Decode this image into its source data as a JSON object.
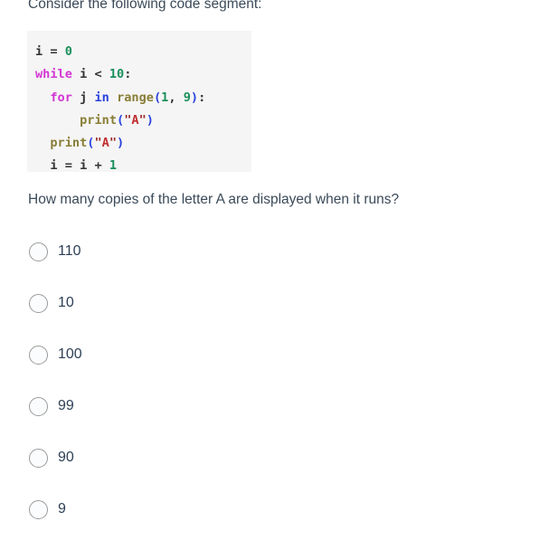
{
  "prompt": "Consider the following code segment:",
  "code": {
    "language": "python",
    "lines": [
      [
        {
          "t": "i",
          "c": "tok-name"
        },
        {
          "t": " ",
          "c": "tok-plain"
        },
        {
          "t": "=",
          "c": "tok-plain"
        },
        {
          "t": " ",
          "c": "tok-plain"
        },
        {
          "t": "0",
          "c": "tok-num"
        }
      ],
      [
        {
          "t": "while",
          "c": "tok-kw"
        },
        {
          "t": " ",
          "c": "tok-plain"
        },
        {
          "t": "i",
          "c": "tok-name"
        },
        {
          "t": " ",
          "c": "tok-plain"
        },
        {
          "t": "<",
          "c": "tok-plain"
        },
        {
          "t": " ",
          "c": "tok-plain"
        },
        {
          "t": "10",
          "c": "tok-num"
        },
        {
          "t": ":",
          "c": "tok-plain"
        }
      ],
      [
        {
          "t": "  ",
          "c": "tok-plain"
        },
        {
          "t": "for",
          "c": "tok-kw"
        },
        {
          "t": " ",
          "c": "tok-plain"
        },
        {
          "t": "j",
          "c": "tok-name"
        },
        {
          "t": " ",
          "c": "tok-plain"
        },
        {
          "t": "in",
          "c": "tok-op-in"
        },
        {
          "t": " ",
          "c": "tok-plain"
        },
        {
          "t": "range",
          "c": "tok-builtin"
        },
        {
          "t": "(",
          "c": "tok-punc"
        },
        {
          "t": "1",
          "c": "tok-num"
        },
        {
          "t": ",",
          "c": "tok-plain"
        },
        {
          "t": " ",
          "c": "tok-plain"
        },
        {
          "t": "9",
          "c": "tok-num"
        },
        {
          "t": ")",
          "c": "tok-punc"
        },
        {
          "t": ":",
          "c": "tok-plain"
        }
      ],
      [
        {
          "t": "      ",
          "c": "tok-plain"
        },
        {
          "t": "print",
          "c": "tok-builtin"
        },
        {
          "t": "(",
          "c": "tok-punc"
        },
        {
          "t": "\"",
          "c": "tok-str"
        },
        {
          "t": "A",
          "c": "tok-str-in"
        },
        {
          "t": "\"",
          "c": "tok-str"
        },
        {
          "t": ")",
          "c": "tok-punc"
        }
      ],
      [
        {
          "t": "  ",
          "c": "tok-plain"
        },
        {
          "t": "print",
          "c": "tok-builtin"
        },
        {
          "t": "(",
          "c": "tok-punc"
        },
        {
          "t": "\"",
          "c": "tok-str"
        },
        {
          "t": "A",
          "c": "tok-str-in"
        },
        {
          "t": "\"",
          "c": "tok-str"
        },
        {
          "t": ")",
          "c": "tok-punc"
        }
      ],
      [
        {
          "t": "  ",
          "c": "tok-plain"
        },
        {
          "t": "i",
          "c": "tok-name"
        },
        {
          "t": " ",
          "c": "tok-plain"
        },
        {
          "t": "=",
          "c": "tok-plain"
        },
        {
          "t": " ",
          "c": "tok-plain"
        },
        {
          "t": "i",
          "c": "tok-name"
        },
        {
          "t": " ",
          "c": "tok-plain"
        },
        {
          "t": "+",
          "c": "tok-plain"
        },
        {
          "t": " ",
          "c": "tok-plain"
        },
        {
          "t": "1",
          "c": "tok-num"
        }
      ]
    ]
  },
  "question": "How many copies of the letter A are displayed when it runs?",
  "options": [
    {
      "label": "110",
      "selected": false
    },
    {
      "label": "10",
      "selected": false
    },
    {
      "label": "100",
      "selected": false
    },
    {
      "label": "99",
      "selected": false
    },
    {
      "label": "90",
      "selected": false
    },
    {
      "label": "9",
      "selected": false
    }
  ],
  "colors": {
    "page_background": "#ffffff",
    "code_background": "#f5f5f5",
    "body_text": "#3b4a59",
    "option_text": "#2e4057",
    "radio_border": "#9a9a9a",
    "keyword": "#d336d3",
    "number": "#1a8f5a",
    "builtin": "#897e36",
    "string": "#c02f2f",
    "operator_in": "#2a42dd"
  }
}
